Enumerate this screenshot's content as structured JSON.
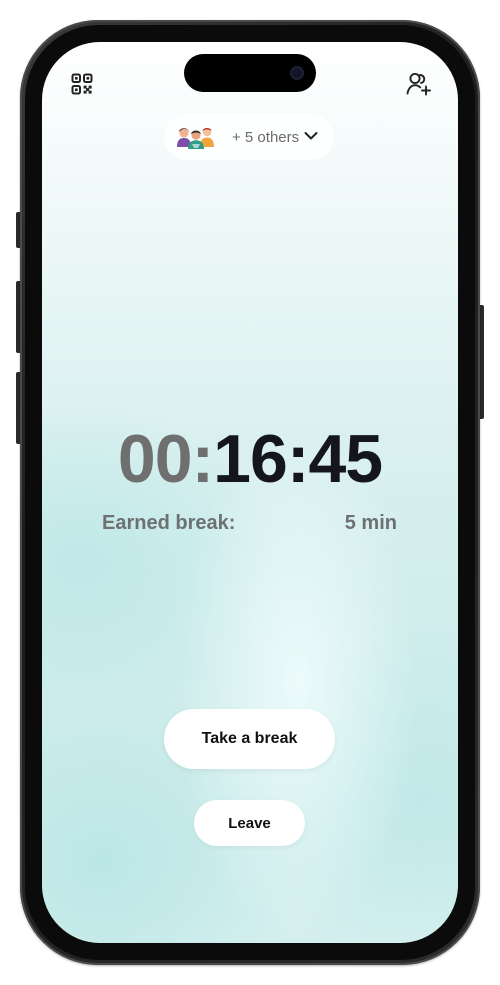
{
  "header": {
    "participants": {
      "others_label": "+ 5 others"
    }
  },
  "timer": {
    "hours": "00",
    "separator_dim": ":",
    "minutes": "16",
    "separator": ":",
    "seconds": "45"
  },
  "earned_break": {
    "label": "Earned break:",
    "value": "5 min"
  },
  "actions": {
    "take_break_label": "Take a break",
    "leave_label": "Leave"
  },
  "icons": {
    "top_left": "qr-code-icon",
    "top_right": "add-user-icon",
    "pill_chevron": "chevron-down-icon"
  },
  "colors": {
    "timer_dim": "#6f6f6f",
    "timer_main": "#15161c",
    "secondary_text": "#6d7172",
    "background_tint": "#cdeceb"
  }
}
